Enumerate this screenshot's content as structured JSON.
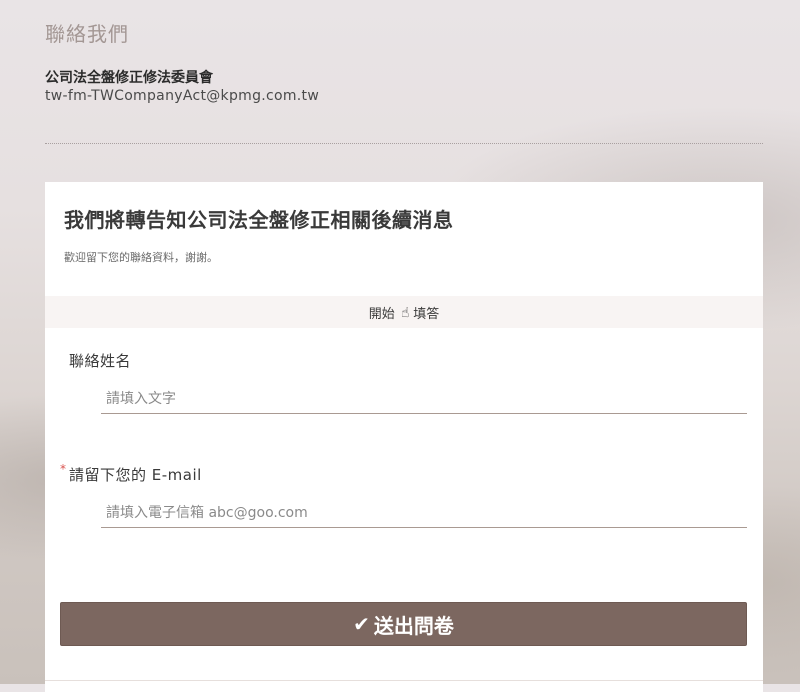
{
  "page": {
    "heading": "聯絡我們",
    "committee": "公司法全盤修正修法委員會",
    "email": "tw-fm-TWCompanyAct@kpmg.com.tw"
  },
  "form": {
    "title": "我們將轉告知公司法全盤修正相關後續消息",
    "subtitle": "歡迎留下您的聯絡資料，謝謝。",
    "start_bar": {
      "before": "開始",
      "icon": "pointing-hand-icon",
      "after": "填答"
    },
    "questions": [
      {
        "label": "聯絡姓名",
        "required": false,
        "placeholder": "請填入文字",
        "value": ""
      },
      {
        "label": "請留下您的 E-mail",
        "required": true,
        "required_mark": "*",
        "placeholder": "請填入電子信箱 abc@goo.com",
        "value": ""
      }
    ],
    "submit": {
      "icon": "check-icon",
      "label": "送出問卷"
    }
  },
  "colors": {
    "button": "#7c6760",
    "heading": "#a39794",
    "required": "#d9534f",
    "underline": "#a99a92"
  }
}
